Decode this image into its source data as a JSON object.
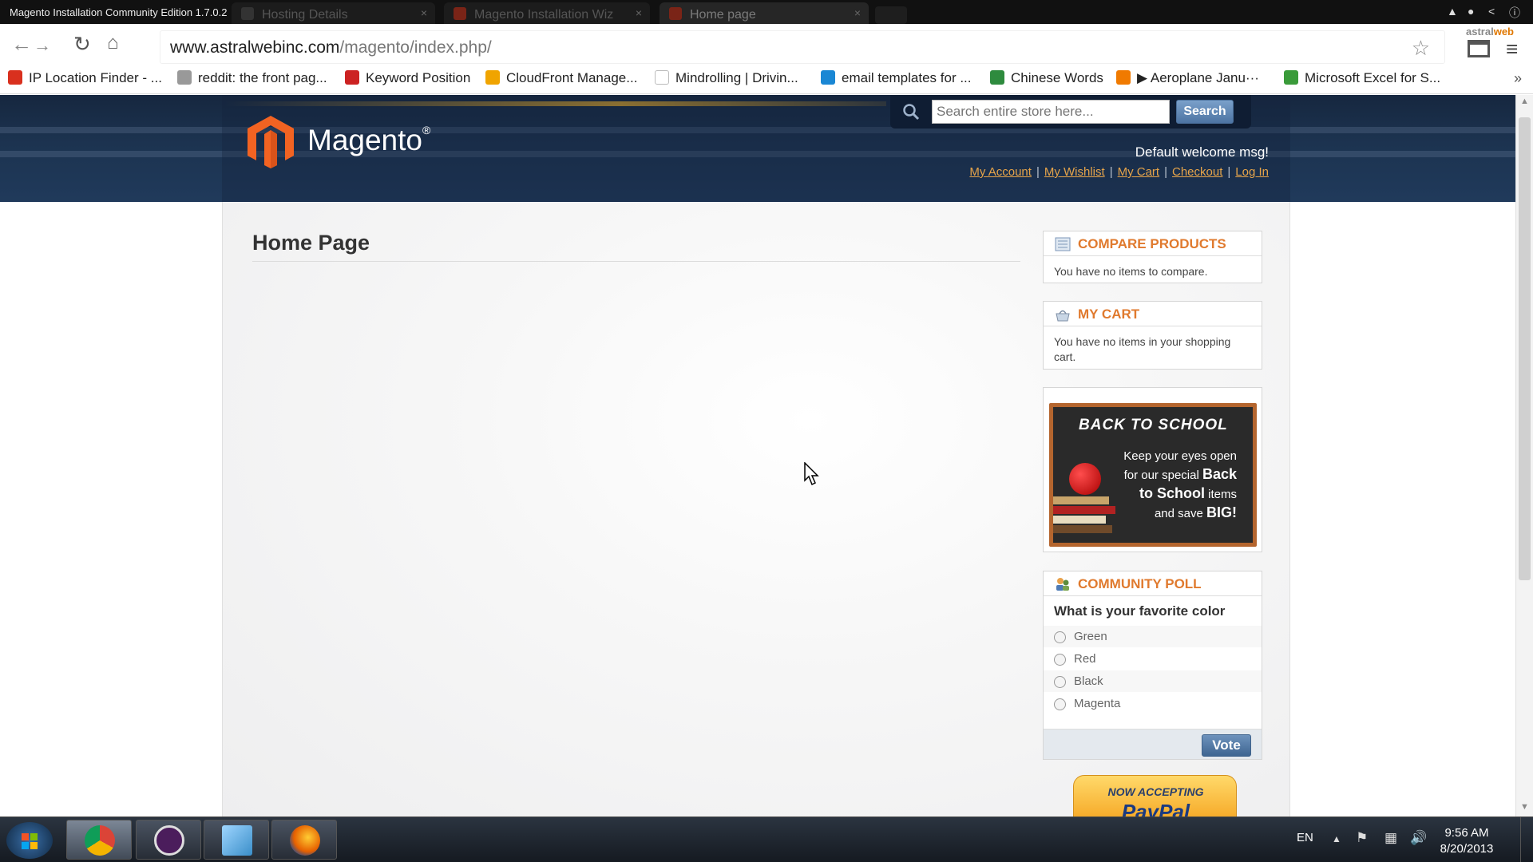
{
  "window": {
    "title": "Magento Installation Community Edition 1.7.0.2",
    "tabs": [
      {
        "label": "Hosting Details",
        "close": "×"
      },
      {
        "label": "Magento Installation Wiz",
        "close": "×"
      },
      {
        "label": "Home page",
        "close": "×"
      }
    ]
  },
  "toolbar": {
    "url_host": "www.astralwebinc.com",
    "url_path": "/magento/index.php/",
    "badge_brand": "astral",
    "badge_accent": "web"
  },
  "bookmarks": [
    {
      "label": "IP Location Finder - ...",
      "color": "#d9301e"
    },
    {
      "label": "reddit: the front pag...",
      "color": "#999999"
    },
    {
      "label": "Keyword Position",
      "color": "#cc2222"
    },
    {
      "label": "CloudFront Manage...",
      "color": "#f0a400"
    },
    {
      "label": "Mindrolling | Drivin...",
      "color": "#cccccc"
    },
    {
      "label": "email templates for ...",
      "color": "#1a87d4"
    },
    {
      "label": "Chinese Words",
      "color": "#2e8b3e"
    },
    {
      "label": "Aeroplane Janu···",
      "color": "#f07a00"
    },
    {
      "label": "Microsoft Excel for S...",
      "color": "#3a9b3a"
    }
  ],
  "store": {
    "logo_text": "Magento",
    "logo_mark": "®",
    "search_placeholder": "Search entire store here...",
    "search_button": "Search",
    "welcome": "Default welcome msg!",
    "links": [
      "My Account",
      "My Wishlist",
      "My Cart",
      "Checkout",
      "Log In"
    ],
    "link_separator": "|"
  },
  "main": {
    "page_title": "Home Page"
  },
  "sidebar": {
    "compare": {
      "title": "COMPARE PRODUCTS",
      "body": "You have no items to compare."
    },
    "cart": {
      "title": "MY CART",
      "body": "You have no items in your shopping cart."
    },
    "promo": {
      "title": "BACK TO SCHOOL",
      "line1": "Keep your eyes open",
      "line2": "for our special",
      "em1": "Back",
      "line3": "to School",
      "line4": "items",
      "line5": "and save",
      "em2": "BIG!"
    },
    "poll": {
      "title": "COMMUNITY POLL",
      "question": "What is your favorite color",
      "options": [
        "Green",
        "Red",
        "Black",
        "Magenta"
      ],
      "vote_button": "Vote"
    },
    "paypal": {
      "top": "NOW ACCEPTING",
      "logo": "PayPal"
    }
  },
  "taskbar": {
    "language": "EN",
    "time": "9:56 AM",
    "date": "8/20/2013"
  },
  "colors": {
    "header_navy": "#1c3350",
    "accent_orange": "#e07a2e",
    "link_orange": "#e6a44a",
    "button_blue": "#4d74a3"
  }
}
